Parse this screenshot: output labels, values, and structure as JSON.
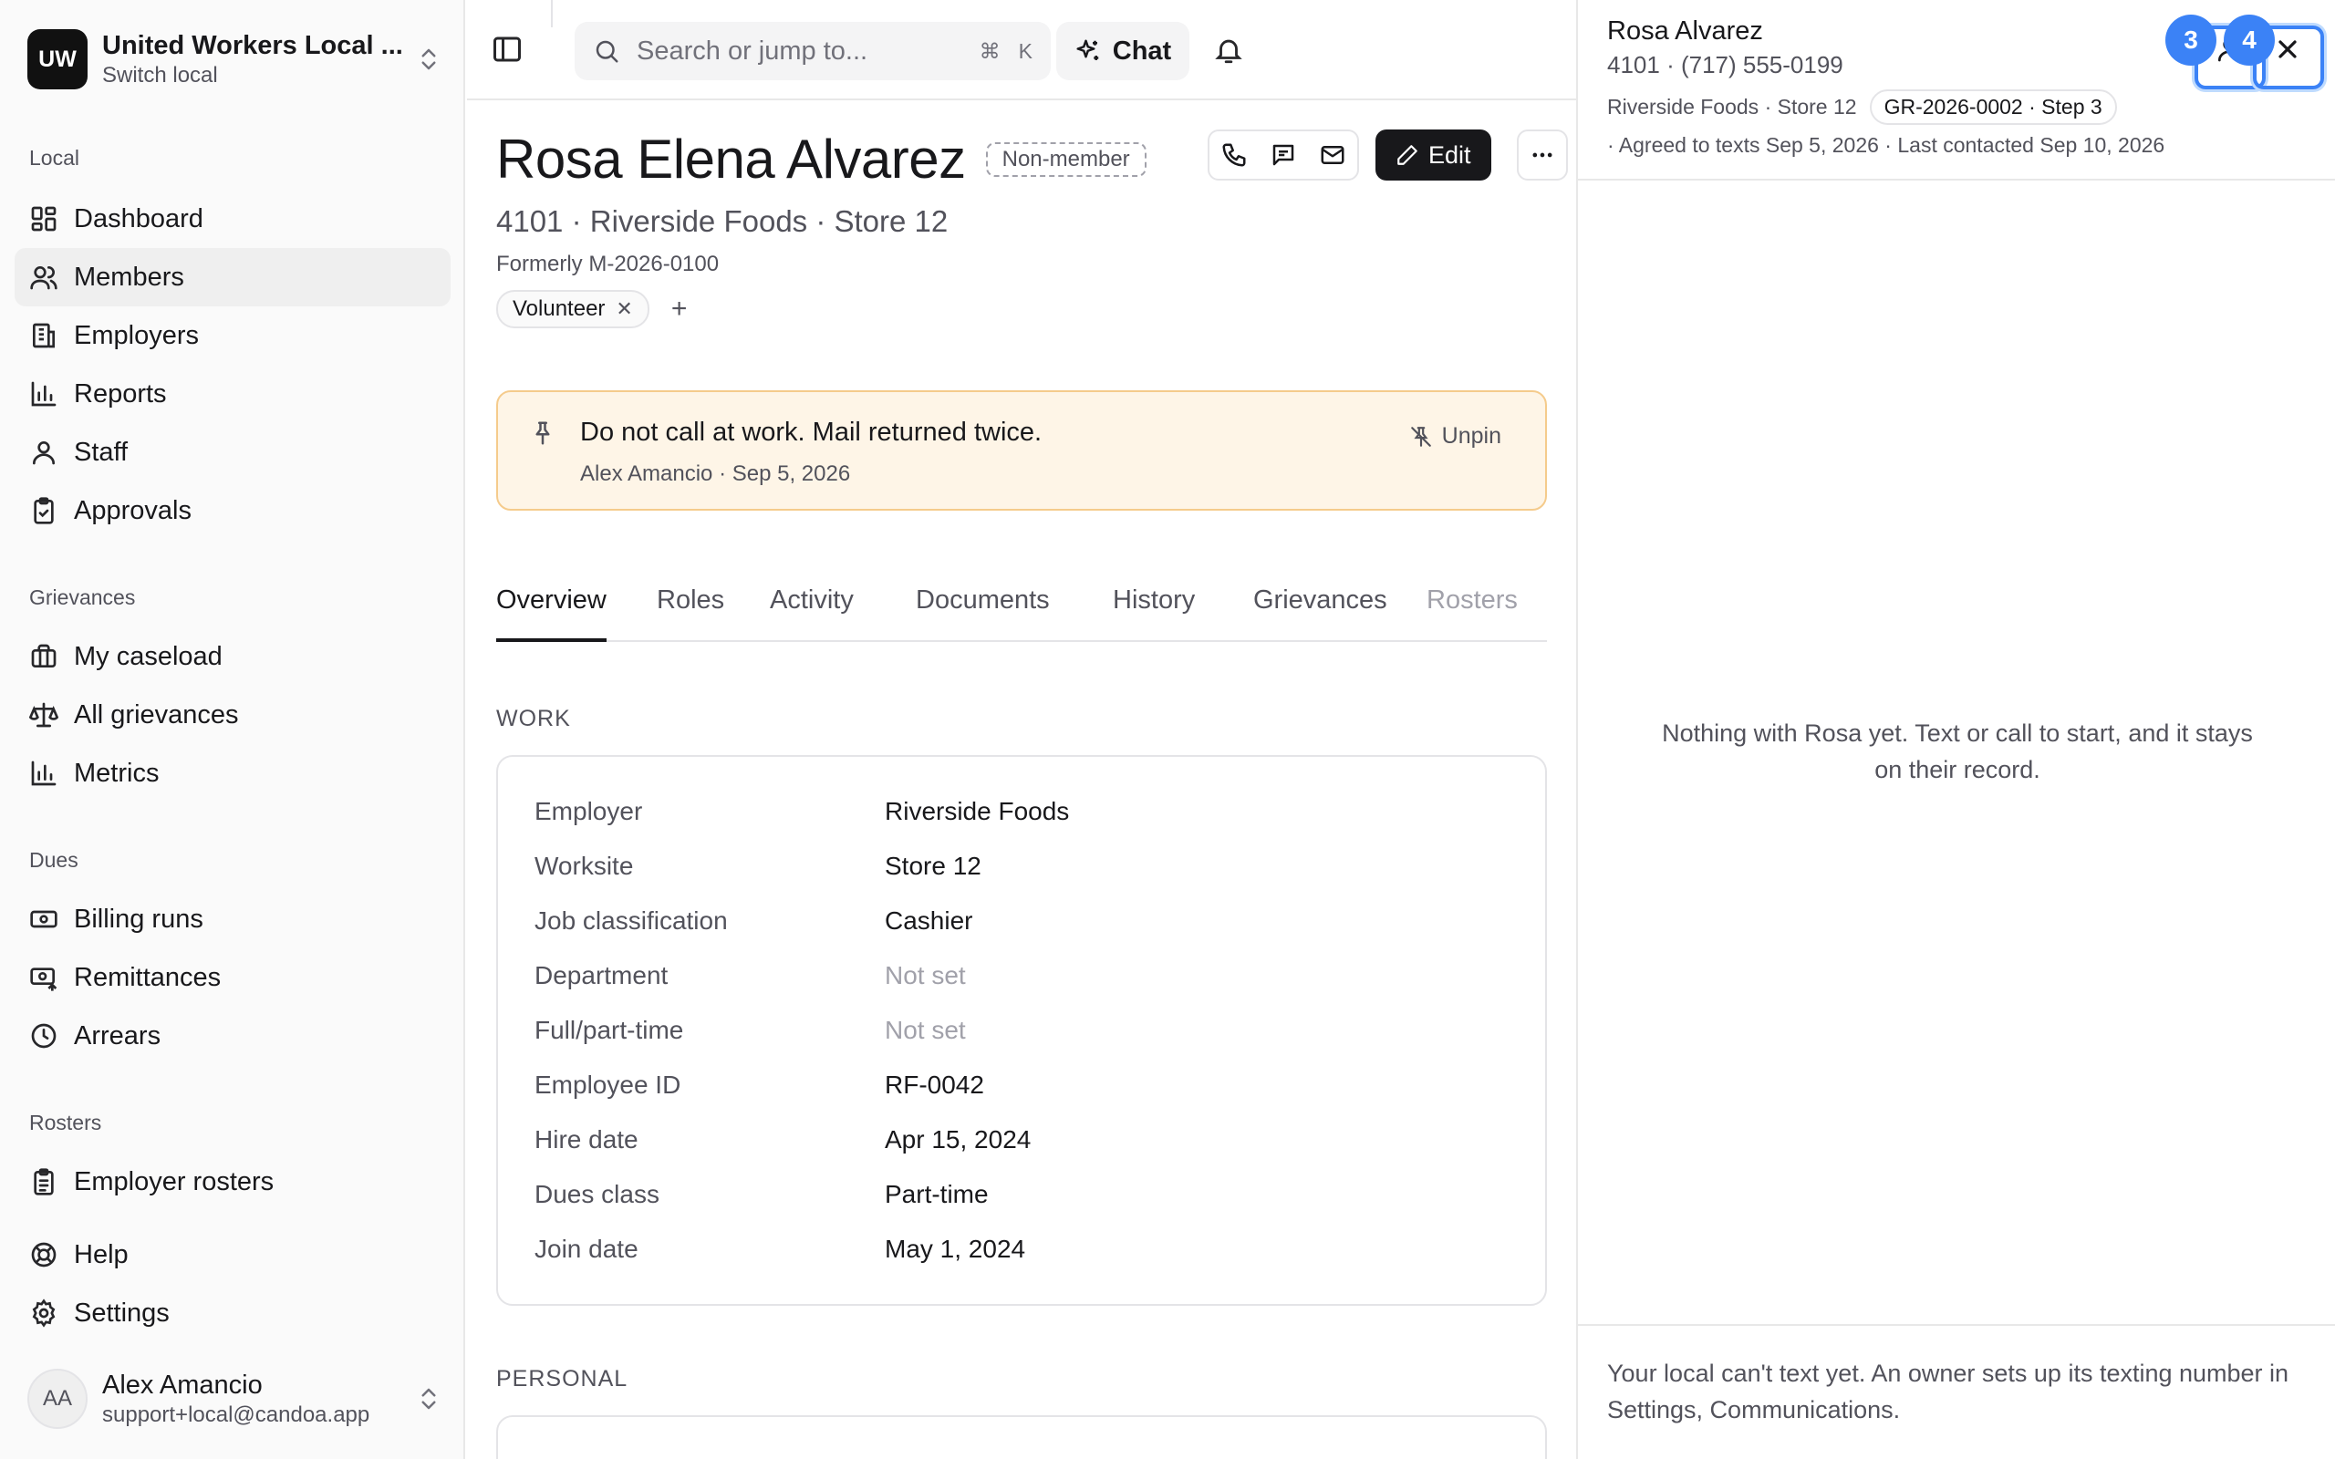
{
  "org": {
    "initials": "UW",
    "name": "United Workers Local ...",
    "sub": "Switch local"
  },
  "nav": {
    "local_label": "Local",
    "local_items": [
      {
        "label": "Dashboard",
        "icon": "dashboard-icon"
      },
      {
        "label": "Members",
        "icon": "users-icon",
        "active": true
      },
      {
        "label": "Employers",
        "icon": "building-icon"
      },
      {
        "label": "Reports",
        "icon": "bar-chart-icon"
      },
      {
        "label": "Staff",
        "icon": "user-icon"
      },
      {
        "label": "Approvals",
        "icon": "clipboard-check-icon"
      }
    ],
    "grievances_label": "Grievances",
    "grievance_items": [
      {
        "label": "My caseload",
        "icon": "briefcase-icon"
      },
      {
        "label": "All grievances",
        "icon": "scale-icon"
      },
      {
        "label": "Metrics",
        "icon": "bar-chart-icon"
      }
    ],
    "dues_label": "Dues",
    "dues_items": [
      {
        "label": "Billing runs",
        "icon": "banknote-icon"
      },
      {
        "label": "Remittances",
        "icon": "receipt-icon"
      },
      {
        "label": "Arrears",
        "icon": "clock-icon"
      }
    ],
    "rosters_label": "Rosters",
    "roster_items": [
      {
        "label": "Employer rosters",
        "icon": "clipboard-list-icon"
      }
    ],
    "bottom_items": [
      {
        "label": "Help",
        "icon": "life-buoy-icon"
      },
      {
        "label": "Settings",
        "icon": "gear-icon"
      }
    ]
  },
  "user": {
    "initials": "AA",
    "name": "Alex Amancio",
    "email": "support+local@candoa.app"
  },
  "topbar": {
    "search_placeholder": "Search or jump to...",
    "kbd_cmd": "⌘",
    "kbd_k": "K",
    "chat_label": "Chat"
  },
  "member": {
    "name": "Rosa Elena Alvarez",
    "status_badge": "Non-member",
    "subline": "4101 · Riverside Foods · Store 12",
    "formerly": "Formerly M-2026-0100",
    "tags": [
      "Volunteer"
    ],
    "edit_label": "Edit"
  },
  "pin": {
    "text": "Do not call at work. Mail returned twice.",
    "meta": "Alex Amancio · Sep 5, 2026",
    "unpin_label": "Unpin"
  },
  "tabs": [
    "Overview",
    "Roles",
    "Activity",
    "Documents",
    "History",
    "Grievances",
    "Rosters"
  ],
  "work": {
    "section_label": "WORK",
    "fields": [
      {
        "label": "Employer",
        "value": "Riverside Foods"
      },
      {
        "label": "Worksite",
        "value": "Store 12"
      },
      {
        "label": "Job classification",
        "value": "Cashier"
      },
      {
        "label": "Department",
        "value": "Not set",
        "muted": true
      },
      {
        "label": "Full/part-time",
        "value": "Not set",
        "muted": true
      },
      {
        "label": "Employee ID",
        "value": "RF-0042"
      },
      {
        "label": "Hire date",
        "value": "Apr 15, 2024"
      },
      {
        "label": "Dues class",
        "value": "Part-time"
      },
      {
        "label": "Join date",
        "value": "May 1, 2024"
      }
    ]
  },
  "personal": {
    "section_label": "PERSONAL"
  },
  "panel": {
    "name": "Rosa Alvarez",
    "phone": "4101 · (717) 555-0199",
    "employer": "Riverside Foods · Store 12",
    "grievance_chip": "GR-2026-0002 · Step 3",
    "meta": "· Agreed to texts Sep 5, 2026   · Last contacted Sep 10, 2026",
    "badge_a": "3",
    "badge_b": "4",
    "empty_text": "Nothing with Rosa yet. Text or call to start, and it stays on their record.",
    "footer_text": "Your local can't text yet. An owner sets up its texting number in Settings, Communications."
  }
}
